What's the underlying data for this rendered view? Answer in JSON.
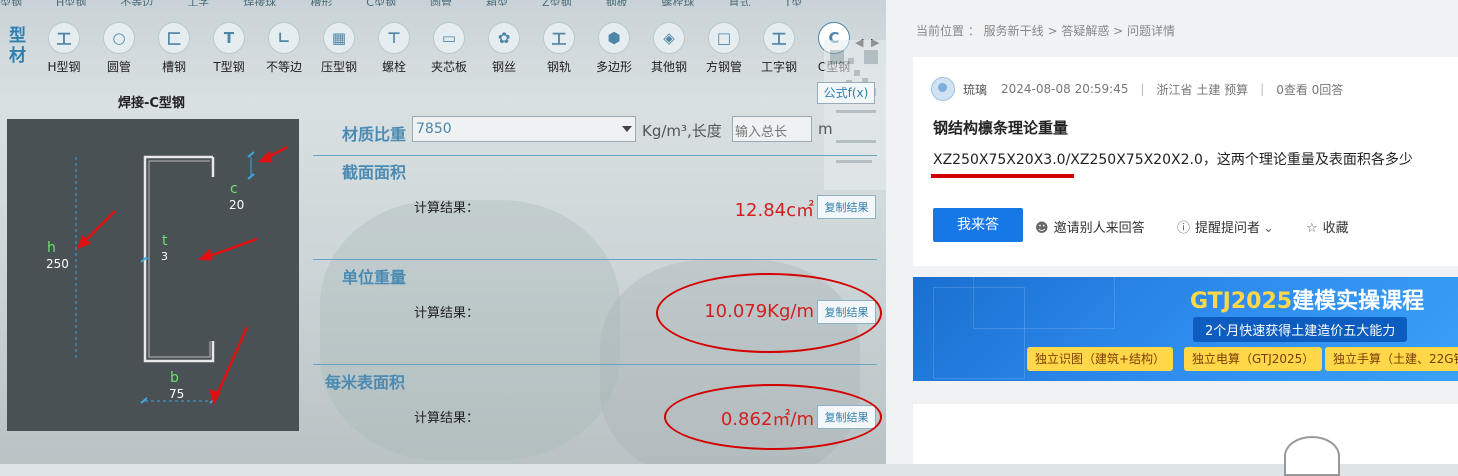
{
  "top_menu": [
    "型钢",
    "H型钢",
    "不等边",
    "工字",
    "焊接球",
    "槽形",
    "C型钢",
    "圆管",
    "箱型",
    "Z型钢",
    "钢板",
    "螺栓球",
    "直式",
    "T型"
  ],
  "category_label": "型材",
  "shapes": [
    {
      "label": "H型钢",
      "icon": "h-beam-icon",
      "glyph": "工"
    },
    {
      "label": "圆管",
      "icon": "round-tube-icon",
      "glyph": "○"
    },
    {
      "label": "槽钢",
      "icon": "channel-icon",
      "glyph": "匚"
    },
    {
      "label": "T型钢",
      "icon": "t-beam-icon",
      "glyph": "T"
    },
    {
      "label": "不等边",
      "icon": "unequal-angle-icon",
      "glyph": "∟"
    },
    {
      "label": "压型钢",
      "icon": "profiled-sheet-icon",
      "glyph": "▦"
    },
    {
      "label": "螺栓",
      "icon": "bolt-icon",
      "glyph": "⊤"
    },
    {
      "label": "夹芯板",
      "icon": "sandwich-panel-icon",
      "glyph": "▭"
    },
    {
      "label": "钢丝",
      "icon": "wire-icon",
      "glyph": "✿"
    },
    {
      "label": "钢轨",
      "icon": "rail-icon",
      "glyph": "工"
    },
    {
      "label": "多边形",
      "icon": "polygon-icon",
      "glyph": "⬢"
    },
    {
      "label": "其他钢",
      "icon": "other-steel-icon",
      "glyph": "◈"
    },
    {
      "label": "方钢管",
      "icon": "square-tube-icon",
      "glyph": "□"
    },
    {
      "label": "工字钢",
      "icon": "i-beam-icon",
      "glyph": "工"
    },
    {
      "label": "C型钢",
      "icon": "c-section-icon",
      "glyph": "C"
    }
  ],
  "nav_arrows": "◀ ▶",
  "close_glyph": "×",
  "diagram": {
    "title": "焊接-C型钢",
    "dims": {
      "h": {
        "name": "h",
        "value": "250"
      },
      "t": {
        "name": "t",
        "value": "3"
      },
      "c": {
        "name": "c",
        "value": "20"
      },
      "b": {
        "name": "b",
        "value": "75"
      }
    }
  },
  "formula_button": "公式f(x)",
  "density": {
    "label": "材质比重",
    "value": "7850",
    "unit": "Kg/m³,长度",
    "length_placeholder": "输入总长",
    "length_unit": "m"
  },
  "sections": [
    {
      "title": "截面面积",
      "calc_label": "计算结果：",
      "result": "12.84c㎡",
      "copy": "复制结果"
    },
    {
      "title": "单位重量",
      "calc_label": "计算结果：",
      "result": "10.079Kg/m",
      "copy": "复制结果"
    },
    {
      "title": "每米表面积",
      "calc_label": "计算结果：",
      "result": "0.862㎡/m",
      "copy": "复制结果"
    }
  ],
  "web": {
    "breadcrumb": "当前位置 ： 服务新干线 > 答疑解惑 > 问题详情",
    "user": "琉璃",
    "datetime": "2024-08-08 20:59:45",
    "location": "浙江省 土建 预算",
    "stats": "0查看 0回答",
    "question_title": "钢结构檩条理论重量",
    "question_body": "XZ250X75X20X3.0/XZ250X75X20X2.0，这两个理论重量及表面积各多少",
    "answer_button": "我来答",
    "invite": "邀请别人来回答",
    "remind": "提醒提问者",
    "favorite": "收藏",
    "banner": {
      "title_prefix": "GTJ2025",
      "title_suffix": "建模实操课程",
      "subtitle": "2个月快速获得土建造价五大能力",
      "pills": [
        "独立识图（建筑+结构）",
        "独立电算（GTJ2025）",
        "独立手算（土建、22G钢"
      ]
    }
  }
}
